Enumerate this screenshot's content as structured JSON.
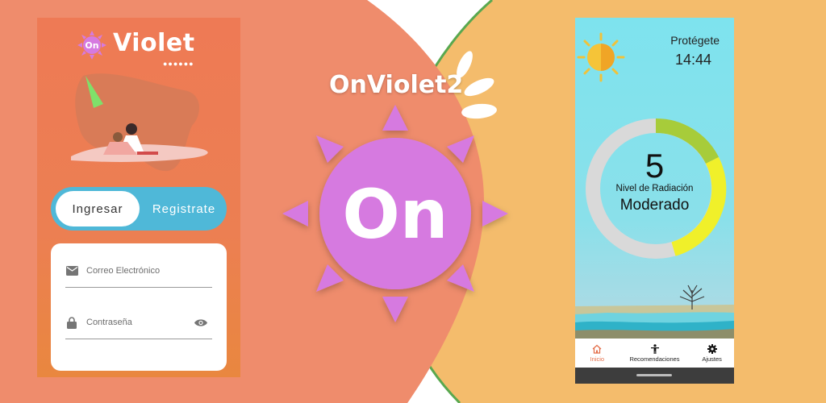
{
  "colors": {
    "left_bg": "#ef8c6c",
    "right_bg": "#f4bc6c",
    "accent_purple": "#d67ae0",
    "toggle_blue": "#4fb8d8",
    "gauge_green": "#a7cc3a",
    "gauge_yellow": "#f0f02a",
    "gauge_gray": "#d9d9d9",
    "active_nav": "#e46f4b"
  },
  "brand": {
    "logo_badge": "On",
    "logo_word": "Violet",
    "center_title": "OnViolet2",
    "center_badge": "On"
  },
  "login": {
    "tabs": [
      {
        "label": "Ingresar",
        "active": true
      },
      {
        "label": "Registrate",
        "active": false
      }
    ],
    "email": {
      "placeholder": "Correo Electrónico",
      "icon": "mail-icon"
    },
    "password": {
      "placeholder": "Contraseña",
      "icon": "lock-icon",
      "toggle_icon": "eye-icon"
    }
  },
  "uv_screen": {
    "header_text": "Protégete",
    "time": "14:44",
    "uv_index": "5",
    "caption": "Nivel de Radiación",
    "level": "Moderado",
    "gauge_fraction": 0.45,
    "nav": [
      {
        "label": "Inicio",
        "icon": "home-icon",
        "active": true
      },
      {
        "label": "Recomendaciones",
        "icon": "person-icon",
        "active": false
      },
      {
        "label": "Ajustes",
        "icon": "gear-icon",
        "active": false
      }
    ]
  }
}
